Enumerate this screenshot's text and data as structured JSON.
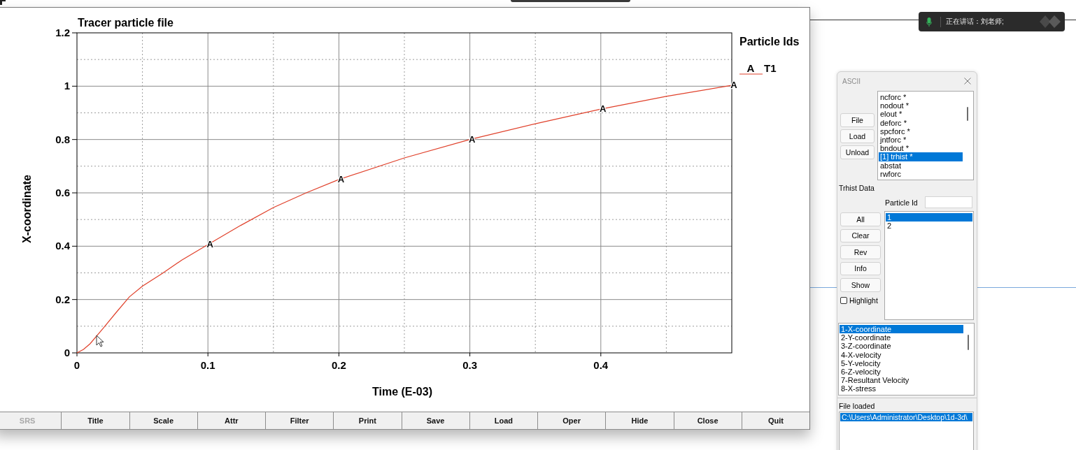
{
  "plot_window": {
    "chart_data": {
      "type": "line",
      "title": "Tracer particle file",
      "xlabel": "Time (E-03)",
      "ylabel": "X-coordinate",
      "x": [
        0,
        0.005,
        0.01,
        0.02,
        0.03,
        0.04,
        0.05,
        0.065,
        0.08,
        0.1,
        0.125,
        0.15,
        0.175,
        0.2,
        0.25,
        0.3,
        0.35,
        0.4,
        0.45,
        0.5
      ],
      "series": [
        {
          "name": "T1",
          "color": "#e0402a",
          "values": [
            0,
            0.013,
            0.034,
            0.092,
            0.152,
            0.21,
            0.25,
            0.297,
            0.348,
            0.406,
            0.478,
            0.545,
            0.6,
            0.65,
            0.731,
            0.8,
            0.859,
            0.914,
            0.962,
            1.003
          ]
        }
      ],
      "xlim": [
        0,
        0.5
      ],
      "ylim": [
        0,
        1.2
      ],
      "xticks": [
        0,
        0.1,
        0.2,
        0.3,
        0.4
      ],
      "yticks": [
        0,
        0.2,
        0.4,
        0.6,
        0.8,
        1,
        1.2
      ],
      "grid": true,
      "annotations": [
        {
          "x": 0.1,
          "y": 0.406,
          "text": "A"
        },
        {
          "x": 0.2,
          "y": 0.65,
          "text": "A"
        },
        {
          "x": 0.3,
          "y": 0.8,
          "text": "A"
        },
        {
          "x": 0.4,
          "y": 0.914,
          "text": "A"
        },
        {
          "x": 0.5,
          "y": 1.003,
          "text": "A"
        }
      ]
    },
    "legend": {
      "title": "Particle Ids",
      "entries": [
        {
          "symbol": "A"
        }
      ]
    },
    "buttons": [
      {
        "label": "SRS",
        "disabled": true
      },
      {
        "label": "Title",
        "disabled": false
      },
      {
        "label": "Scale",
        "disabled": false
      },
      {
        "label": "Attr",
        "disabled": false
      },
      {
        "label": "Filter",
        "disabled": false
      },
      {
        "label": "Print",
        "disabled": false
      },
      {
        "label": "Save",
        "disabled": false
      },
      {
        "label": "Load",
        "disabled": false
      },
      {
        "label": "Oper",
        "disabled": false
      },
      {
        "label": "Hide",
        "disabled": false
      },
      {
        "label": "Close",
        "disabled": false
      },
      {
        "label": "Quit",
        "disabled": false
      }
    ]
  },
  "notification": {
    "text": "正在讲话：刘老师;"
  },
  "ascii_panel": {
    "title": "ASCII",
    "file_buttons": [
      "File",
      "Load",
      "Unload"
    ],
    "files": [
      {
        "label": "ncforc *",
        "selected": false
      },
      {
        "label": "nodout *",
        "selected": false
      },
      {
        "label": "elout *",
        "selected": false
      },
      {
        "label": "deforc *",
        "selected": false
      },
      {
        "label": "spcforc *",
        "selected": false
      },
      {
        "label": "jntforc *",
        "selected": false
      },
      {
        "label": "bndout *",
        "selected": false
      },
      {
        "label": "[1] trhist *",
        "selected": true
      },
      {
        "label": "abstat",
        "selected": false
      },
      {
        "label": "rwforc",
        "selected": false
      }
    ],
    "trhist_label": "Trhist Data",
    "particle_id_label": "Particle Id",
    "particle_buttons": [
      "All",
      "Clear",
      "Rev",
      "Info",
      "Show"
    ],
    "highlight": {
      "label": "Highlight",
      "checked": false
    },
    "particles": [
      {
        "label": "1",
        "selected": true
      },
      {
        "label": "2",
        "selected": false
      }
    ],
    "components": [
      {
        "label": "1-X-coordinate",
        "selected": true
      },
      {
        "label": "2-Y-coordinate",
        "selected": false
      },
      {
        "label": "3-Z-coordinate",
        "selected": false
      },
      {
        "label": "4-X-velocity",
        "selected": false
      },
      {
        "label": "5-Y-velocity",
        "selected": false
      },
      {
        "label": "6-Z-velocity",
        "selected": false
      },
      {
        "label": "7-Resultant Velocity",
        "selected": false
      },
      {
        "label": "8-X-stress",
        "selected": false
      }
    ],
    "file_loaded_label": "File loaded",
    "loaded_files": [
      {
        "label": "C:\\Users\\Administrator\\Desktop\\1d-3d\\",
        "selected": true
      }
    ]
  }
}
